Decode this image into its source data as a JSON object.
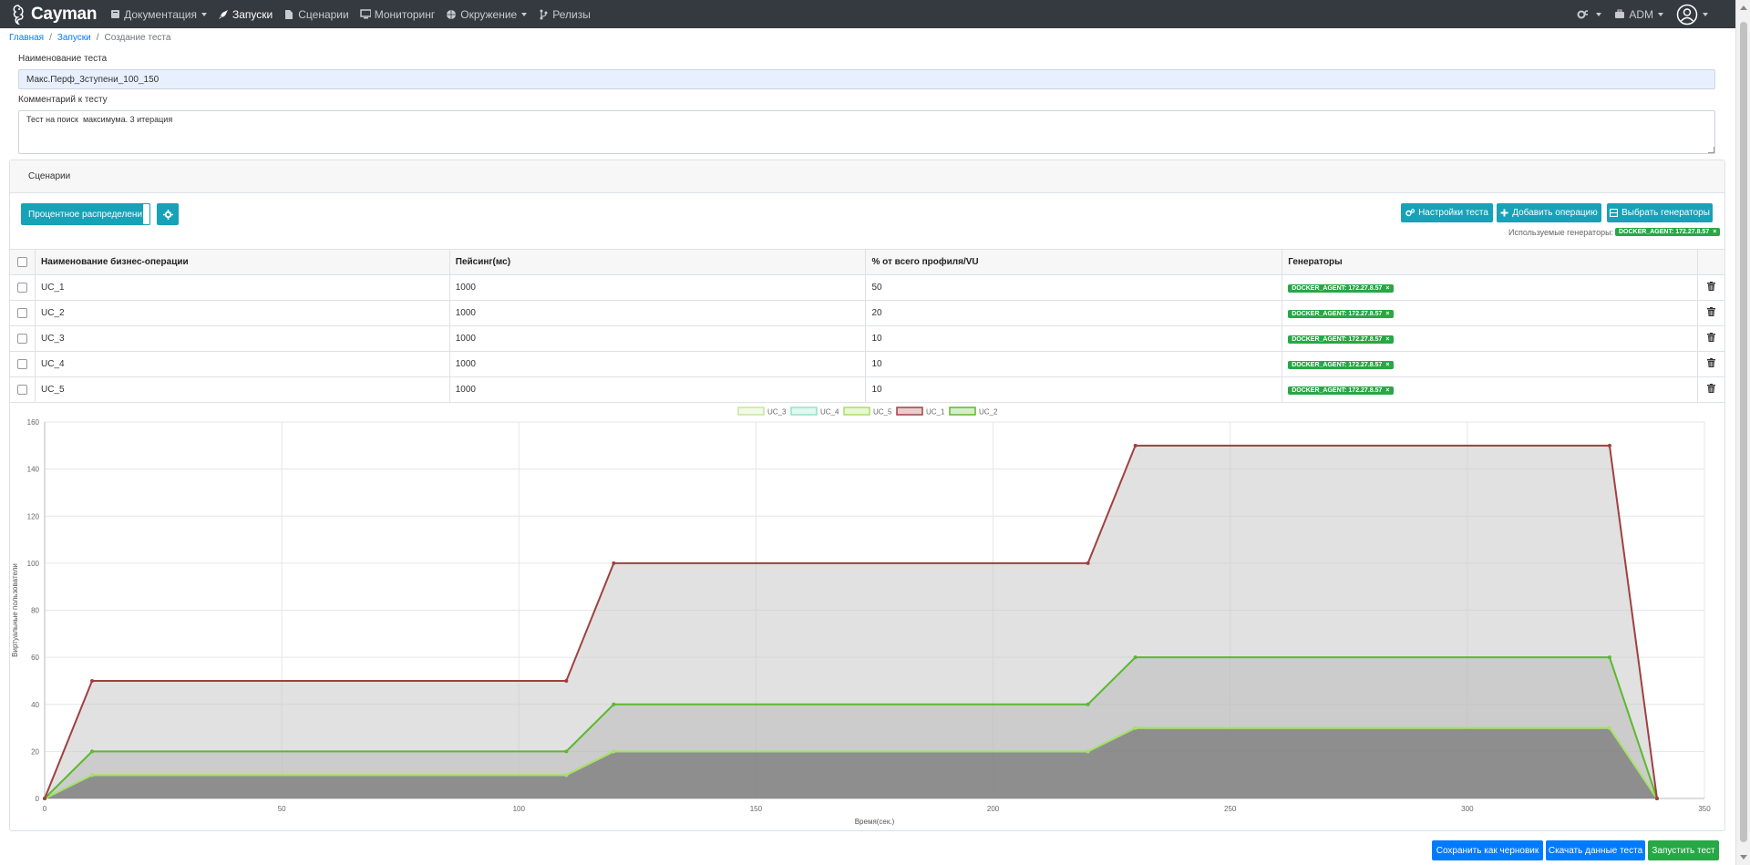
{
  "app": {
    "brand": "Cayman"
  },
  "nav": {
    "items": [
      {
        "label": "Документация",
        "icon": "book-icon",
        "dropdown": true,
        "active": false
      },
      {
        "label": "Запуски",
        "icon": "rocket-icon",
        "dropdown": false,
        "active": true
      },
      {
        "label": "Сценарии",
        "icon": "file-icon",
        "dropdown": false,
        "active": false
      },
      {
        "label": "Мониторинг",
        "icon": "monitor-icon",
        "dropdown": false,
        "active": false
      },
      {
        "label": "Окружение",
        "icon": "globe-icon",
        "dropdown": true,
        "active": false
      },
      {
        "label": "Релизы",
        "icon": "code-branch-icon",
        "dropdown": false,
        "active": false
      }
    ],
    "user": "ADM"
  },
  "breadcrumb": {
    "home": "Главная",
    "runs": "Запуски",
    "current": "Создание теста"
  },
  "form": {
    "name_label": "Наименование теста",
    "name_value": "Макс.Перф_3ступени_100_150",
    "comment_label": "Комментарий к тесту",
    "comment_value": "Тест на поиск  максимума. 3 итерация"
  },
  "scenarios": {
    "header": "Сценарии",
    "distribution_button": "Процентное распределение",
    "test_settings_button": "Настройки теста",
    "add_operation_button": "Добавить операцию",
    "select_generators_button": "Выбрать генераторы",
    "used_generators_label": "Используемые генераторы:",
    "used_generator": "DOCKER_AGENT: 172.27.8.57",
    "table": {
      "headers": [
        "Наименование бизнес-операции",
        "Пейсинг(мс)",
        "% от всего профиля/VU",
        "Генераторы"
      ],
      "rows": [
        {
          "name": "UC_1",
          "pacing": "1000",
          "percent": "50",
          "generator": "DOCKER_AGENT: 172.27.8.57"
        },
        {
          "name": "UC_2",
          "pacing": "1000",
          "percent": "20",
          "generator": "DOCKER_AGENT: 172.27.8.57"
        },
        {
          "name": "UC_3",
          "pacing": "1000",
          "percent": "10",
          "generator": "DOCKER_AGENT: 172.27.8.57"
        },
        {
          "name": "UC_4",
          "pacing": "1000",
          "percent": "10",
          "generator": "DOCKER_AGENT: 172.27.8.57"
        },
        {
          "name": "UC_5",
          "pacing": "1000",
          "percent": "10",
          "generator": "DOCKER_AGENT: 172.27.8.57"
        }
      ]
    }
  },
  "chart_data": {
    "type": "area",
    "xlabel": "Время(сек.)",
    "ylabel": "Виртуальные пользователи",
    "xlim": [
      0,
      350
    ],
    "ylim": [
      0,
      160
    ],
    "xticks": [
      0,
      50,
      100,
      150,
      200,
      250,
      300,
      350
    ],
    "yticks": [
      0,
      20,
      40,
      60,
      80,
      100,
      120,
      140,
      160
    ],
    "grid": true,
    "legend_position": "top",
    "x": [
      0,
      10,
      110,
      120,
      220,
      230,
      330,
      340
    ],
    "series": [
      {
        "name": "UC_3",
        "color": "#c8e6a0",
        "values": [
          0,
          10,
          10,
          20,
          20,
          30,
          30,
          0
        ]
      },
      {
        "name": "UC_4",
        "color": "#8fe3c8",
        "values": [
          0,
          10,
          10,
          20,
          20,
          30,
          30,
          0
        ]
      },
      {
        "name": "UC_5",
        "color": "#a8e063",
        "values": [
          0,
          10,
          10,
          20,
          20,
          30,
          30,
          0
        ]
      },
      {
        "name": "UC_1",
        "color": "#a04040",
        "values": [
          0,
          50,
          50,
          100,
          100,
          150,
          150,
          0
        ]
      },
      {
        "name": "UC_2",
        "color": "#5cb82e",
        "values": [
          0,
          20,
          20,
          40,
          40,
          60,
          60,
          0
        ]
      }
    ]
  },
  "actions": {
    "save_draft": "Сохранить как черновик",
    "download": "Скачать данные теста",
    "run": "Запустить тест"
  }
}
